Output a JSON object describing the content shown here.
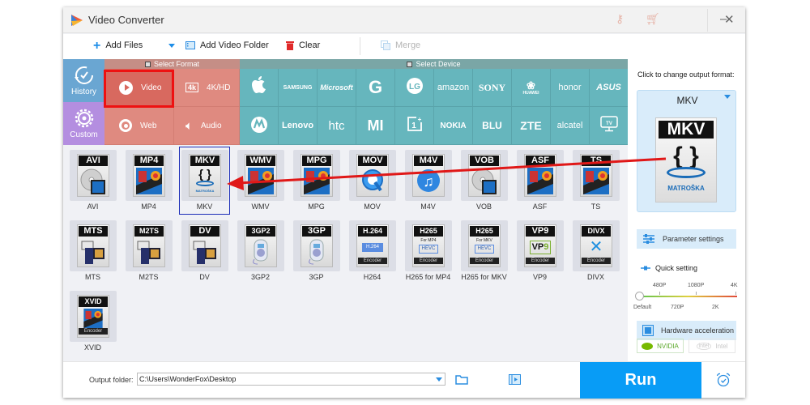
{
  "window": {
    "title": "Video Converter"
  },
  "toolbar": {
    "add_files": "Add Files",
    "add_video_folder": "Add Video Folder",
    "clear": "Clear",
    "merge": "Merge"
  },
  "categories": {
    "select_format_header": "Select Format",
    "select_device_header": "Select Device",
    "history": "History",
    "custom": "Custom",
    "formats": [
      {
        "label": "Video",
        "icon": "play-icon",
        "selected": true
      },
      {
        "label": "4K/HD",
        "icon": "4k-icon"
      },
      {
        "label": "Web",
        "icon": "chrome-icon"
      },
      {
        "label": "Audio",
        "icon": "speaker-icon"
      }
    ],
    "devices_row1": [
      "Apple",
      "SAMSUNG",
      "Microsoft",
      "G",
      "LG",
      "amazon",
      "SONY",
      "HUAWEI",
      "honor",
      "ASUS"
    ],
    "devices_row2": [
      "Motorola",
      "Lenovo",
      "htc",
      "MI",
      "1+",
      "NOKIA",
      "BLU",
      "ZTE",
      "alcatel",
      "TV"
    ]
  },
  "formats_grid": [
    {
      "tag": "AVI",
      "label": "AVI",
      "art": "disc-film"
    },
    {
      "tag": "MP4",
      "label": "MP4",
      "art": "film"
    },
    {
      "tag": "MKV",
      "label": "MKV",
      "art": "matroska",
      "selected": true
    },
    {
      "tag": "WMV",
      "label": "WMV",
      "art": "film"
    },
    {
      "tag": "MPG",
      "label": "MPG",
      "art": "film"
    },
    {
      "tag": "MOV",
      "label": "MOV",
      "art": "quicktime"
    },
    {
      "tag": "M4V",
      "label": "M4V",
      "art": "itunes"
    },
    {
      "tag": "VOB",
      "label": "VOB",
      "art": "disc-film"
    },
    {
      "tag": "ASF",
      "label": "ASF",
      "art": "film"
    },
    {
      "tag": "TS",
      "label": "TS",
      "art": "film"
    },
    {
      "tag": "MTS",
      "label": "MTS",
      "art": "camcorder"
    },
    {
      "tag": "M2TS",
      "label": "M2TS",
      "art": "camcorder"
    },
    {
      "tag": "DV",
      "label": "DV",
      "art": "camcorder"
    },
    {
      "tag": "3GP2",
      "label": "3GP2",
      "art": "player"
    },
    {
      "tag": "3GP",
      "label": "3GP",
      "art": "player"
    },
    {
      "tag": "H.264",
      "label": "H264",
      "art": "encoder",
      "sub": "H.264"
    },
    {
      "tag": "H265",
      "label": "H265 for MP4",
      "art": "encoder",
      "sub": "HEVC",
      "note": "For MP4"
    },
    {
      "tag": "H265",
      "label": "H265 for MKV",
      "art": "encoder",
      "sub": "HEVC",
      "note": "For MKV"
    },
    {
      "tag": "VP9",
      "label": "VP9",
      "art": "encoder",
      "sub": "VP9"
    },
    {
      "tag": "DIVX",
      "label": "DIVX",
      "art": "encoder",
      "sub": "X"
    },
    {
      "tag": "XVID",
      "label": "XVID",
      "art": "encoder-film"
    }
  ],
  "encoder_text": "Encoder",
  "right_panel": {
    "prompt": "Click to change output format:",
    "output_format": "MKV",
    "matroska_text": "MATROŠKA",
    "parameter_settings": "Parameter settings",
    "quick_setting": "Quick setting",
    "quality_ticks_top": [
      "480P",
      "1080P",
      "4K"
    ],
    "quality_ticks_bottom": [
      "Default",
      "720P",
      "2K"
    ],
    "quality_value": "Default",
    "hardware_acceleration": "Hardware acceleration",
    "nvidia": "NVIDIA",
    "intel": "Intel"
  },
  "bottom": {
    "output_folder_label": "Output folder:",
    "output_folder_value": "C:\\Users\\WonderFox\\Desktop",
    "run": "Run"
  },
  "colors": {
    "history_bg": "#6aa6d2",
    "custom_bg": "#b48ee0",
    "format_bg": "#df8a80",
    "format_selected_bg": "#d8695f",
    "device_bg": "#66b6bd",
    "run_bg": "#089cf6",
    "highlight": "#ee1111"
  }
}
